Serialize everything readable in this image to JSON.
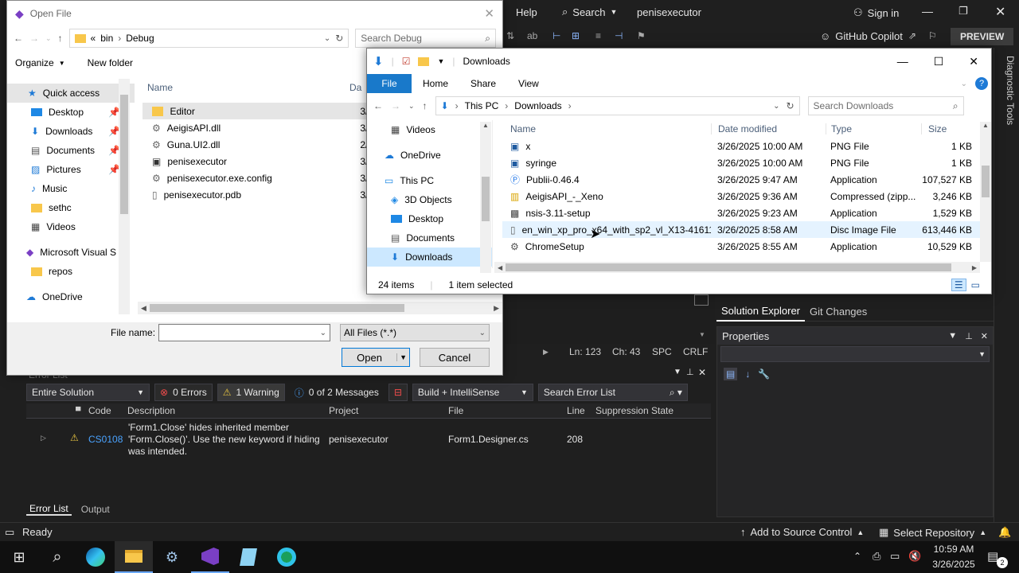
{
  "vs": {
    "menu_help": "Help",
    "search_label": "Search",
    "project_name": "penisexecutor",
    "sign_in": "Sign in",
    "copilot": "GitHub Copilot",
    "preview": "PREVIEW",
    "diagnostic_tools": "Diagnostic Tools",
    "solution_explorer": "Solution Explorer",
    "git_changes": "Git Changes",
    "properties": "Properties",
    "status_ln": "Ln: 123",
    "status_ch": "Ch: 43",
    "status_spc": "SPC",
    "status_crlf": "CRLF",
    "error_list_title": "Error List",
    "scope": "Entire Solution",
    "errors": "0 Errors",
    "warnings": "1 Warning",
    "messages": "0 of 2 Messages",
    "build_filter": "Build + IntelliSense",
    "search_errors": "Search Error List",
    "columns": {
      "code": "Code",
      "description": "Description",
      "project": "Project",
      "file": "File",
      "line": "Line",
      "suppression": "Suppression State"
    },
    "row": {
      "code": "CS0108",
      "description_1": "'Form1.Close' hides inherited member",
      "description_2": "'Form.Close()'. Use the new keyword if hiding",
      "description_3": "was intended.",
      "project": "penisexecutor",
      "file": "Form1.Designer.cs",
      "line": "208"
    },
    "tab_error_list": "Error List",
    "tab_output": "Output",
    "ready": "Ready",
    "add_source_control": "Add to Source Control",
    "select_repository": "Select Repository"
  },
  "taskbar": {
    "time": "10:59 AM",
    "date": "3/26/2025",
    "notifications": "2"
  },
  "openfile": {
    "title": "Open File",
    "path_prefix": "«",
    "path_1": "bin",
    "path_2": "Debug",
    "search_placeholder": "Search Debug",
    "organize": "Organize",
    "new_folder": "New folder",
    "col_name": "Name",
    "col_date_partial": "Da",
    "nav": [
      {
        "label": "Quick access"
      },
      {
        "label": "Desktop"
      },
      {
        "label": "Downloads"
      },
      {
        "label": "Documents"
      },
      {
        "label": "Pictures"
      },
      {
        "label": "Music"
      },
      {
        "label": "sethc"
      },
      {
        "label": "Videos"
      },
      {
        "label": "Microsoft Visual S"
      },
      {
        "label": "repos"
      },
      {
        "label": "OneDrive"
      }
    ],
    "files": [
      {
        "name": "Editor",
        "date": "3/2"
      },
      {
        "name": "AeigisAPI.dll",
        "date": "3/2"
      },
      {
        "name": "Guna.UI2.dll",
        "date": "2/1"
      },
      {
        "name": "penisexecutor",
        "date": "3/2"
      },
      {
        "name": "penisexecutor.exe.config",
        "date": "3/2"
      },
      {
        "name": "penisexecutor.pdb",
        "date": "3/2"
      }
    ],
    "file_name_label": "File name:",
    "file_name_value": "",
    "filter": "All Files (*.*)",
    "open": "Open",
    "cancel": "Cancel"
  },
  "downloads": {
    "title": "Downloads",
    "ribbon": [
      "File",
      "Home",
      "Share",
      "View"
    ],
    "crumb_1": "This PC",
    "crumb_2": "Downloads",
    "search_placeholder": "Search Downloads",
    "nav": [
      {
        "label": "Videos"
      },
      {
        "label": "OneDrive"
      },
      {
        "label": "This PC"
      },
      {
        "label": "3D Objects"
      },
      {
        "label": "Desktop"
      },
      {
        "label": "Documents"
      },
      {
        "label": "Downloads"
      }
    ],
    "columns": {
      "name": "Name",
      "date": "Date modified",
      "type": "Type",
      "size": "Size"
    },
    "files": [
      {
        "name": "x",
        "date": "3/26/2025 10:00 AM",
        "type": "PNG File",
        "size": "1 KB"
      },
      {
        "name": "syringe",
        "date": "3/26/2025 10:00 AM",
        "type": "PNG File",
        "size": "1 KB"
      },
      {
        "name": "Publii-0.46.4",
        "date": "3/26/2025 9:47 AM",
        "type": "Application",
        "size": "107,527 KB"
      },
      {
        "name": "AeigisAPI_-_Xeno",
        "date": "3/26/2025 9:36 AM",
        "type": "Compressed (zipp...",
        "size": "3,246 KB"
      },
      {
        "name": "nsis-3.11-setup",
        "date": "3/26/2025 9:23 AM",
        "type": "Application",
        "size": "1,529 KB"
      },
      {
        "name": "en_win_xp_pro_x64_with_sp2_vl_X13-41611",
        "date": "3/26/2025 8:58 AM",
        "type": "Disc Image File",
        "size": "613,446 KB"
      },
      {
        "name": "ChromeSetup",
        "date": "3/26/2025 8:55 AM",
        "type": "Application",
        "size": "10,529 KB"
      }
    ],
    "item_count": "24 items",
    "selected": "1 item selected"
  }
}
